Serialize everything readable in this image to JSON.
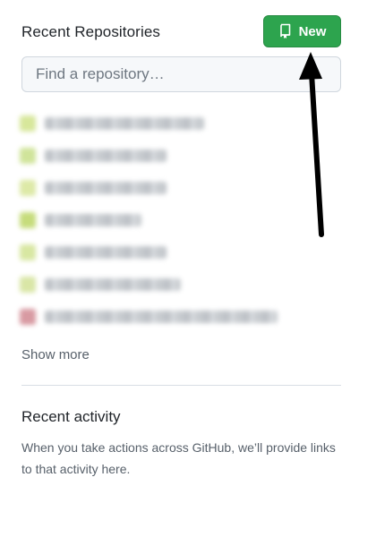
{
  "recent_repositories": {
    "title": "Recent Repositories",
    "new_button_label": "New",
    "search_placeholder": "Find a repository…",
    "show_more_label": "Show more",
    "items": [
      {
        "avatar_color": "#d7e79b"
      },
      {
        "avatar_color": "#d0e49a"
      },
      {
        "avatar_color": "#dde9a7"
      },
      {
        "avatar_color": "#c6dc7b"
      },
      {
        "avatar_color": "#d8e7a2"
      },
      {
        "avatar_color": "#d9e6a6"
      },
      {
        "avatar_color": "#d89aa2"
      }
    ]
  },
  "recent_activity": {
    "title": "Recent activity",
    "description": "When you take actions across GitHub, we’ll provide links to that activity here."
  },
  "colors": {
    "new_button": "#2da44e",
    "annotation_arrow": "#000000"
  }
}
